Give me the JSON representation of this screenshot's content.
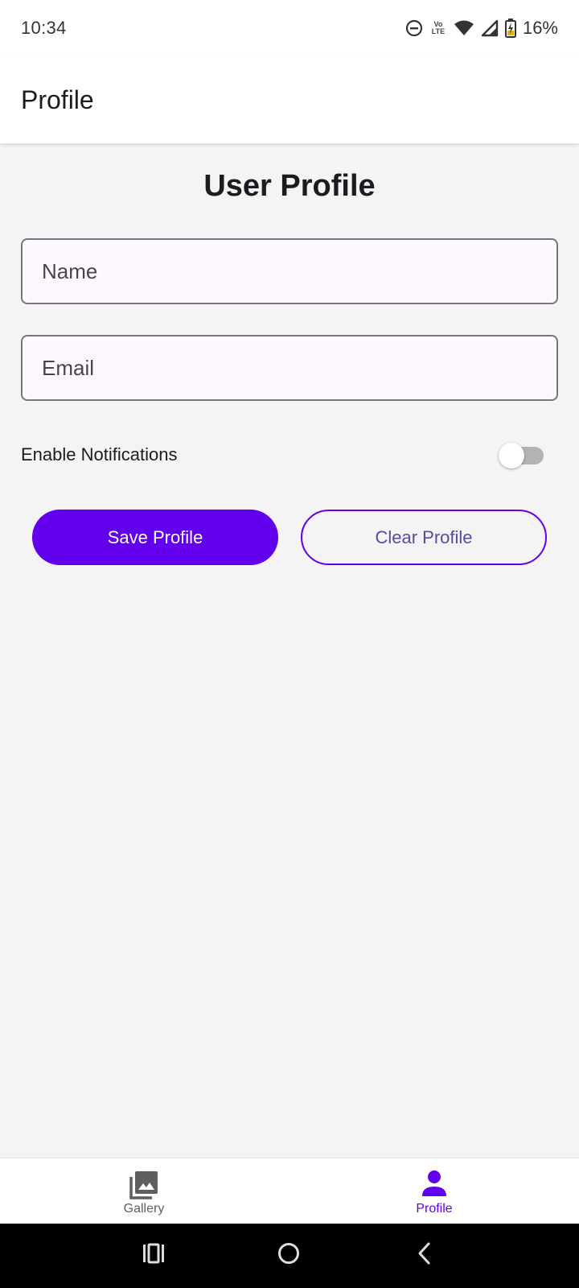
{
  "status_bar": {
    "time": "10:34",
    "network_label": "Vo LTE",
    "battery_percent": "16%",
    "icons": [
      "do-not-disturb-icon",
      "volte-icon",
      "wifi-icon",
      "cellular-signal-icon",
      "battery-charging-icon"
    ]
  },
  "app_bar": {
    "title": "Profile"
  },
  "form": {
    "heading": "User Profile",
    "name_placeholder": "Name",
    "email_placeholder": "Email",
    "notifications_label": "Enable Notifications",
    "notifications_enabled": false,
    "save_label": "Save Profile",
    "clear_label": "Clear Profile"
  },
  "bottom_nav": {
    "items": [
      {
        "label": "Gallery",
        "icon": "gallery-icon",
        "selected": false
      },
      {
        "label": "Profile",
        "icon": "person-icon",
        "selected": true
      }
    ]
  },
  "system_nav": {
    "buttons": [
      "recents-icon",
      "home-icon",
      "back-icon"
    ]
  },
  "colors": {
    "primary": "#6200ee",
    "background": "#f4f4f4",
    "surface": "#ffffff",
    "field_fill": "#fdf8fd",
    "outline": "#79747e",
    "inactive_nav": "#5f5f5f"
  }
}
